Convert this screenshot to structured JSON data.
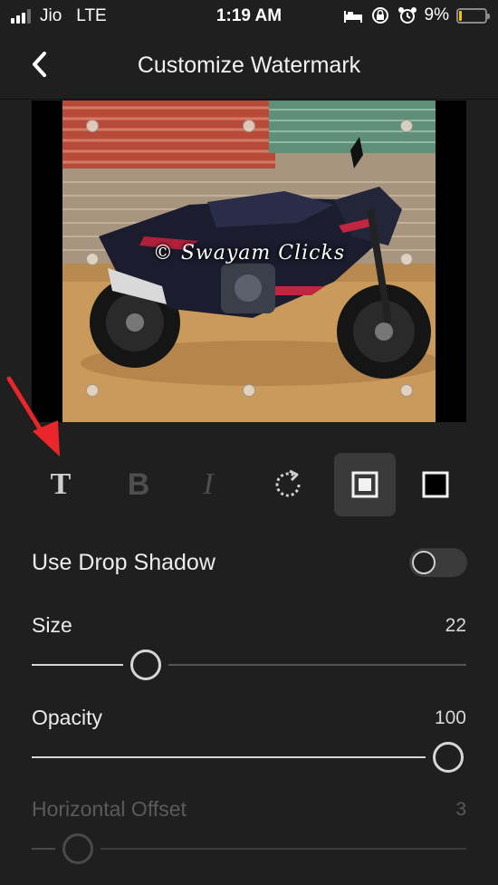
{
  "status_bar": {
    "carrier": "Jio",
    "network": "LTE",
    "time": "1:19 AM",
    "battery_percent": "9%",
    "battery_level": 0.09,
    "battery_color": "#f2c200",
    "icons": [
      "signal-icon",
      "bed-icon",
      "rotation-lock-icon",
      "alarm-icon",
      "battery-icon"
    ]
  },
  "nav": {
    "back_icon": "chevron-left-icon",
    "title": "Customize Watermark"
  },
  "preview": {
    "watermark_text": "© Swayam Clicks"
  },
  "toolbar": {
    "tools": [
      {
        "name": "text-tool",
        "glyph": "T",
        "enabled": true
      },
      {
        "name": "bold-tool",
        "glyph": "B",
        "enabled": false
      },
      {
        "name": "italic-tool",
        "glyph": "I",
        "enabled": false
      },
      {
        "name": "rotate-tool",
        "icon": "rotate-icon",
        "enabled": true
      },
      {
        "name": "align-center-tool",
        "icon": "filled-square-icon",
        "active": true
      },
      {
        "name": "align-fit-tool",
        "icon": "outline-square-icon",
        "active": false
      }
    ],
    "annotation_color": "#e8262b"
  },
  "settings": {
    "drop_shadow": {
      "label": "Use Drop Shadow",
      "enabled": false
    },
    "size": {
      "label": "Size",
      "value": "22",
      "level": 0.24
    },
    "opacity": {
      "label": "Opacity",
      "value": "100",
      "level": 1.0
    },
    "horizontal_offset": {
      "label": "Horizontal Offset",
      "value": "3",
      "level": 0.07,
      "disabled": true
    }
  }
}
